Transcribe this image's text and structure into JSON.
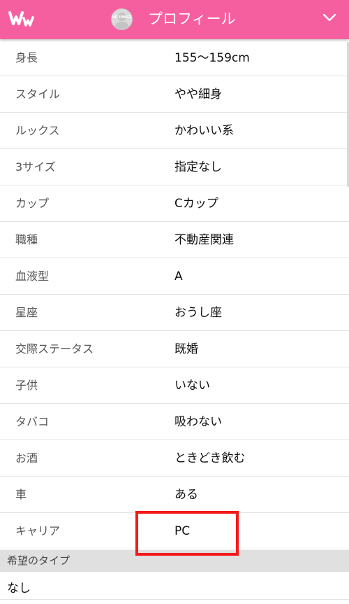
{
  "header": {
    "logo_alt": "WW",
    "avatar_label": "NO IMAGE",
    "title": "プロフィール",
    "bg_color": "#f65f9f"
  },
  "profile": {
    "rows": [
      {
        "label": "身長",
        "value": "155〜159cm"
      },
      {
        "label": "スタイル",
        "value": "やや細身"
      },
      {
        "label": "ルックス",
        "value": "かわいい系"
      },
      {
        "label": "3サイズ",
        "value": "指定なし"
      },
      {
        "label": "カップ",
        "value": "Cカップ"
      },
      {
        "label": "職種",
        "value": "不動産関連"
      },
      {
        "label": "血液型",
        "value": "A"
      },
      {
        "label": "星座",
        "value": "おうし座"
      },
      {
        "label": "交際ステータス",
        "value": "既婚"
      },
      {
        "label": "子供",
        "value": "いない"
      },
      {
        "label": "タバコ",
        "value": "吸わない"
      },
      {
        "label": "お酒",
        "value": "ときどき飲む"
      },
      {
        "label": "車",
        "value": "ある"
      },
      {
        "label": "キャリア",
        "value": "PC"
      }
    ]
  },
  "preferred_type": {
    "title": "希望のタイプ",
    "value": "なし"
  },
  "icons": {
    "logo": "ww-logo",
    "avatar": "no-image-avatar",
    "menu_toggle": "chevron-down-icon"
  },
  "colors": {
    "highlight": "#f41a1a"
  }
}
